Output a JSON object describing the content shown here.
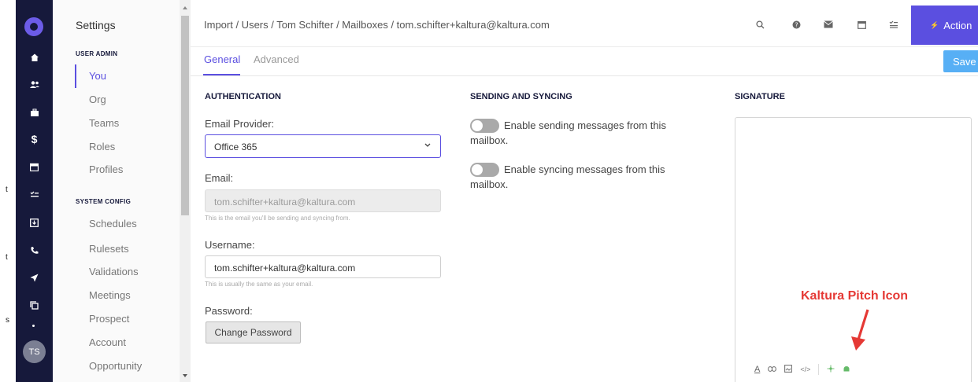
{
  "rail": {
    "avatar_initials": "TS",
    "icons": [
      "logo-icon",
      "home-icon",
      "people-icon",
      "briefcase-icon",
      "dollar-icon",
      "calendar-icon",
      "tasks-icon",
      "import-icon",
      "phone-icon",
      "send-icon",
      "copy-icon"
    ]
  },
  "sidebar": {
    "title": "Settings",
    "section_user_admin": "USER ADMIN",
    "user_admin_items": [
      "You",
      "Org",
      "Teams",
      "Roles",
      "Profiles"
    ],
    "section_system_config": "SYSTEM CONFIG",
    "system_config_items": [
      "Schedules",
      "Rulesets",
      "Validations",
      "Meetings",
      "Prospect",
      "Account",
      "Opportunity"
    ]
  },
  "header": {
    "breadcrumb": "Import / Users / Tom Schifter / Mailboxes / tom.schifter+kaltura@kaltura.com",
    "actions_label": "Action",
    "actions_icon": "⚡"
  },
  "tabs": {
    "general": "General",
    "advanced": "Advanced",
    "save_label": "Save"
  },
  "authentication": {
    "title": "AUTHENTICATION",
    "provider_label": "Email Provider:",
    "provider_value": "Office 365",
    "email_label": "Email:",
    "email_value": "tom.schifter+kaltura@kaltura.com",
    "email_help": "This is the email you'll be sending and syncing from.",
    "username_label": "Username:",
    "username_value": "tom.schifter+kaltura@kaltura.com",
    "username_help": "This is usually the same as your email.",
    "password_label": "Password:",
    "change_password": "Change Password"
  },
  "sending": {
    "title": "SENDING AND SYNCING",
    "toggle_sending": "Enable sending messages from this mailbox.",
    "toggle_syncing": "Enable syncing messages from this mailbox."
  },
  "signature": {
    "title": "SIGNATURE",
    "annotation": "Kaltura Pitch Icon",
    "annotation_color": "#e53935"
  },
  "colors": {
    "accent": "#5b4fe0",
    "rail": "#16193b",
    "save": "#57aff5"
  }
}
